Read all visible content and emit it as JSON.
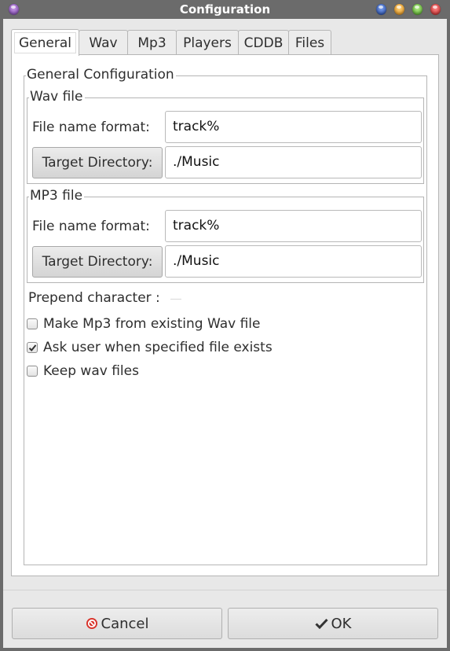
{
  "window": {
    "title": "Configuration",
    "orb_colors": {
      "menu": "#9b59c9",
      "blue": "#2f5fc7",
      "orange": "#f0a330",
      "green": "#6cc03a",
      "red": "#e03a3a"
    }
  },
  "tabs": [
    {
      "label": "General",
      "active": true
    },
    {
      "label": "Wav",
      "active": false
    },
    {
      "label": "Mp3",
      "active": false
    },
    {
      "label": "Players",
      "active": false
    },
    {
      "label": "CDDB",
      "active": false
    },
    {
      "label": "Files",
      "active": false
    }
  ],
  "general": {
    "group_title": "General Configuration",
    "wav": {
      "title": "Wav file",
      "format_label": "File name format:",
      "format_value": "track%",
      "target_button": "Target Directory:",
      "target_value": "./Music"
    },
    "mp3": {
      "title": "MP3 file",
      "format_label": "File name format:",
      "format_value": "track%",
      "target_button": "Target Directory:",
      "target_value": "./Music"
    },
    "prepend_label": "Prepend character :",
    "prepend_value": "",
    "checkboxes": [
      {
        "label": "Make Mp3 from existing Wav file",
        "checked": false
      },
      {
        "label": "Ask user when specified file exists",
        "checked": true
      },
      {
        "label": "Keep wav files",
        "checked": false
      }
    ]
  },
  "buttons": {
    "cancel": "Cancel",
    "cancel_icon": "cancel-icon",
    "ok": "OK",
    "ok_icon": "checkmark-icon",
    "cancel_icon_color": "#d9332b"
  }
}
